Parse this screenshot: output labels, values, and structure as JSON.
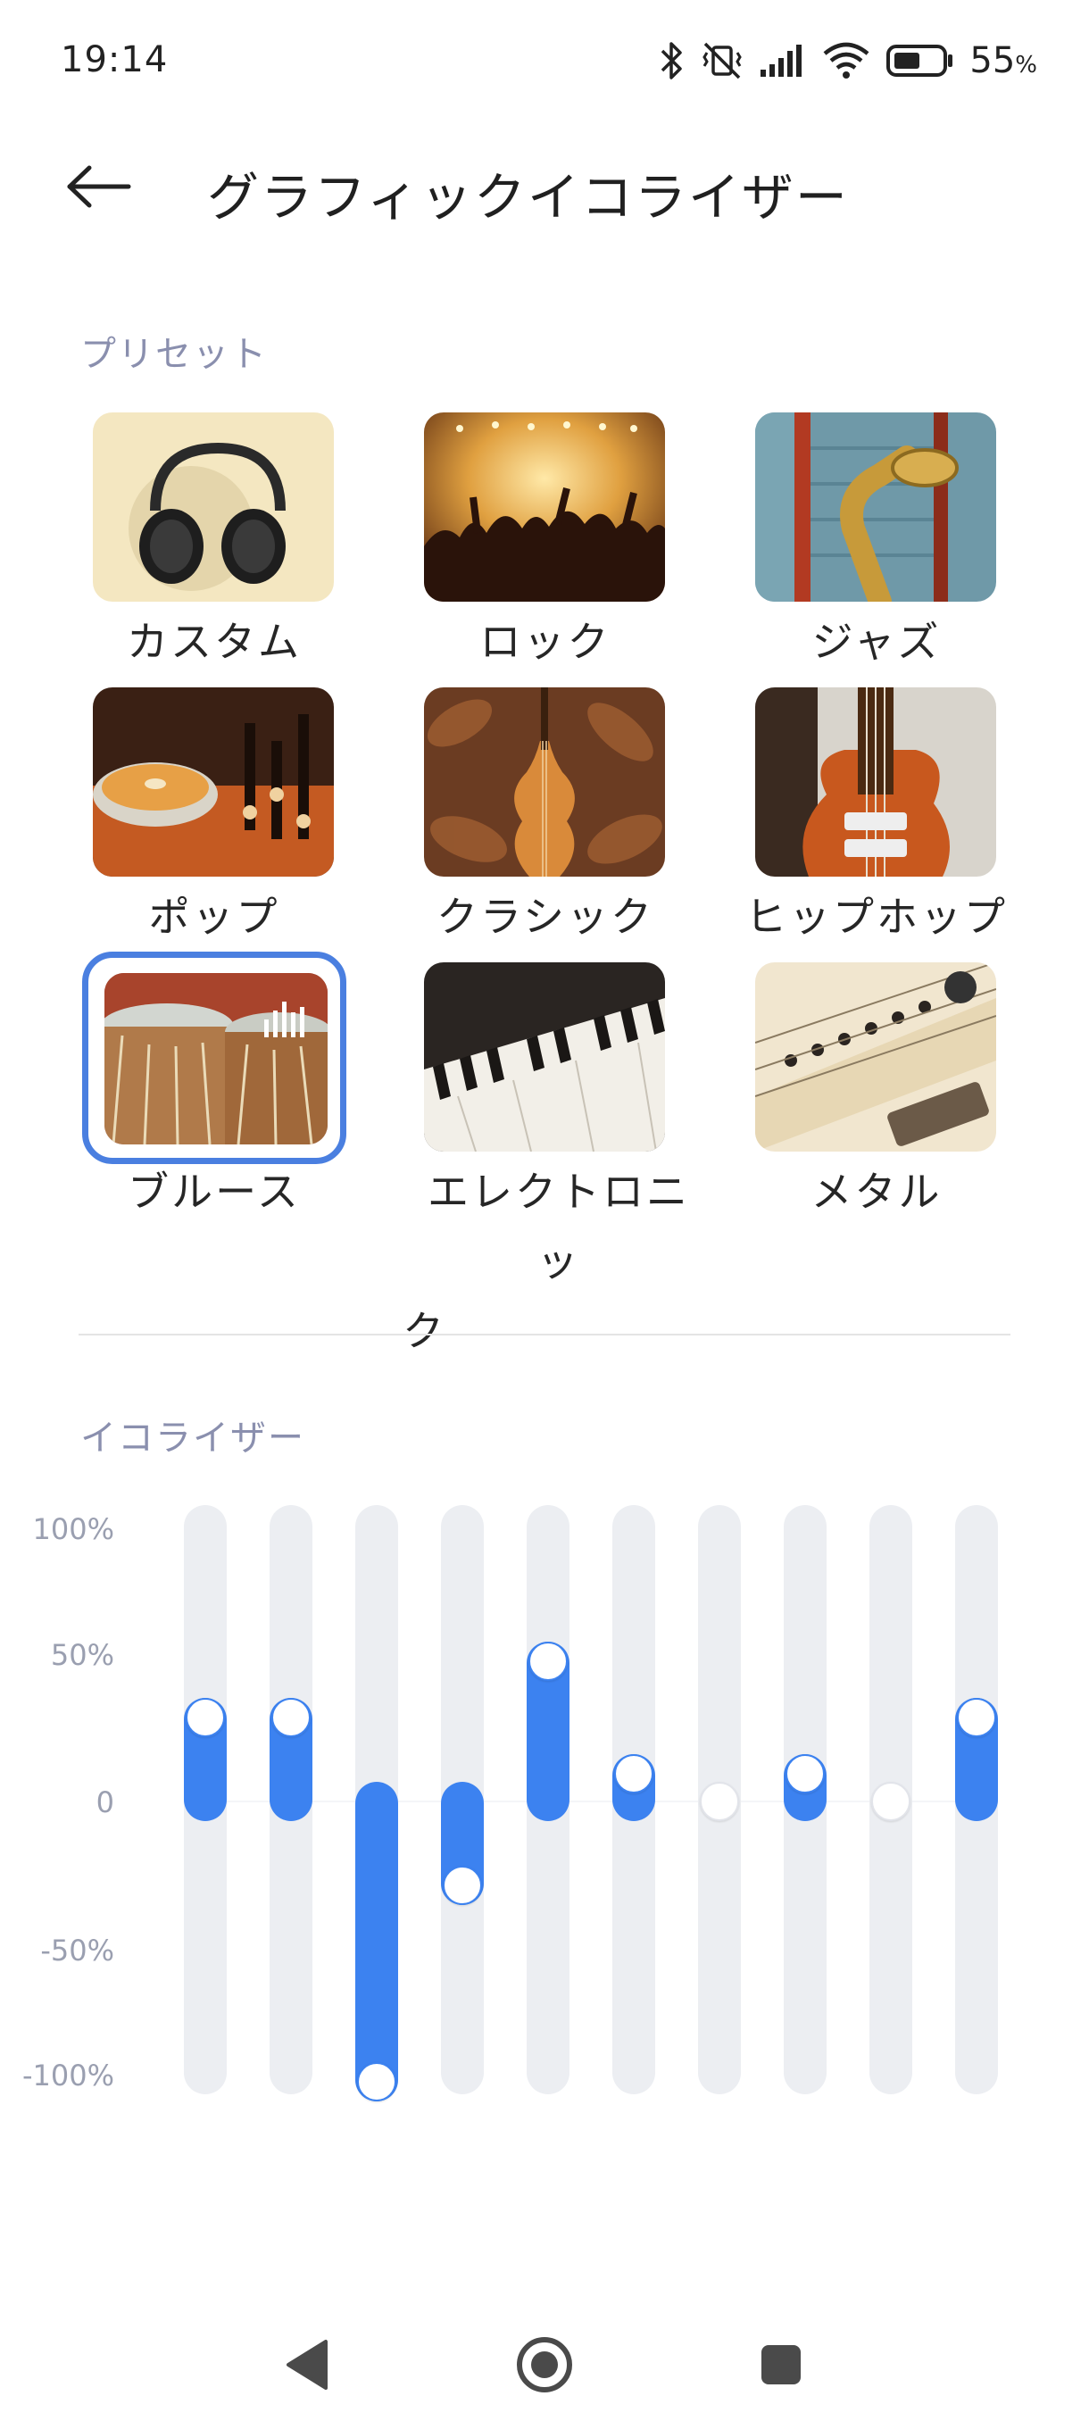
{
  "status_bar": {
    "time": "19:14",
    "battery_percent": "55",
    "battery_unit": "%",
    "battery_level": 0.55,
    "icons": [
      "bluetooth-icon",
      "vibrate-off-icon",
      "signal-icon",
      "wifi-icon",
      "battery-icon"
    ]
  },
  "header": {
    "back_icon": "back-arrow-icon",
    "title": "グラフィックイコライザー"
  },
  "presets": {
    "label": "プリセット",
    "selected": "ブルース",
    "items": [
      {
        "label": "カスタム",
        "image": "headphones"
      },
      {
        "label": "ロック",
        "image": "concert-crowd"
      },
      {
        "label": "ジャズ",
        "image": "saxophone"
      },
      {
        "label": "ポップ",
        "image": "dj-turntable"
      },
      {
        "label": "クラシック",
        "image": "violin"
      },
      {
        "label": "ヒップホップ",
        "image": "electric-guitar"
      },
      {
        "label": "ブルース",
        "image": "tabla-drums"
      },
      {
        "label": "エレクトロニック",
        "label_line1": "エレクトロニッ",
        "label_line2": "ク",
        "image": "keyboard"
      },
      {
        "label": "メタル",
        "image": "guitar-closeup"
      }
    ]
  },
  "equalizer": {
    "label": "イコライザー",
    "axis_labels": [
      "100%",
      "50%",
      "0",
      "-50%",
      "-100%"
    ],
    "bands_percent": [
      30,
      30,
      -100,
      -30,
      50,
      10,
      0,
      10,
      0,
      30
    ],
    "accent_color": "#3c82f0",
    "track_color": "#eceef2"
  },
  "nav_bar": {
    "back": "nav-back-icon",
    "home": "nav-home-icon",
    "recents": "nav-recents-icon"
  }
}
